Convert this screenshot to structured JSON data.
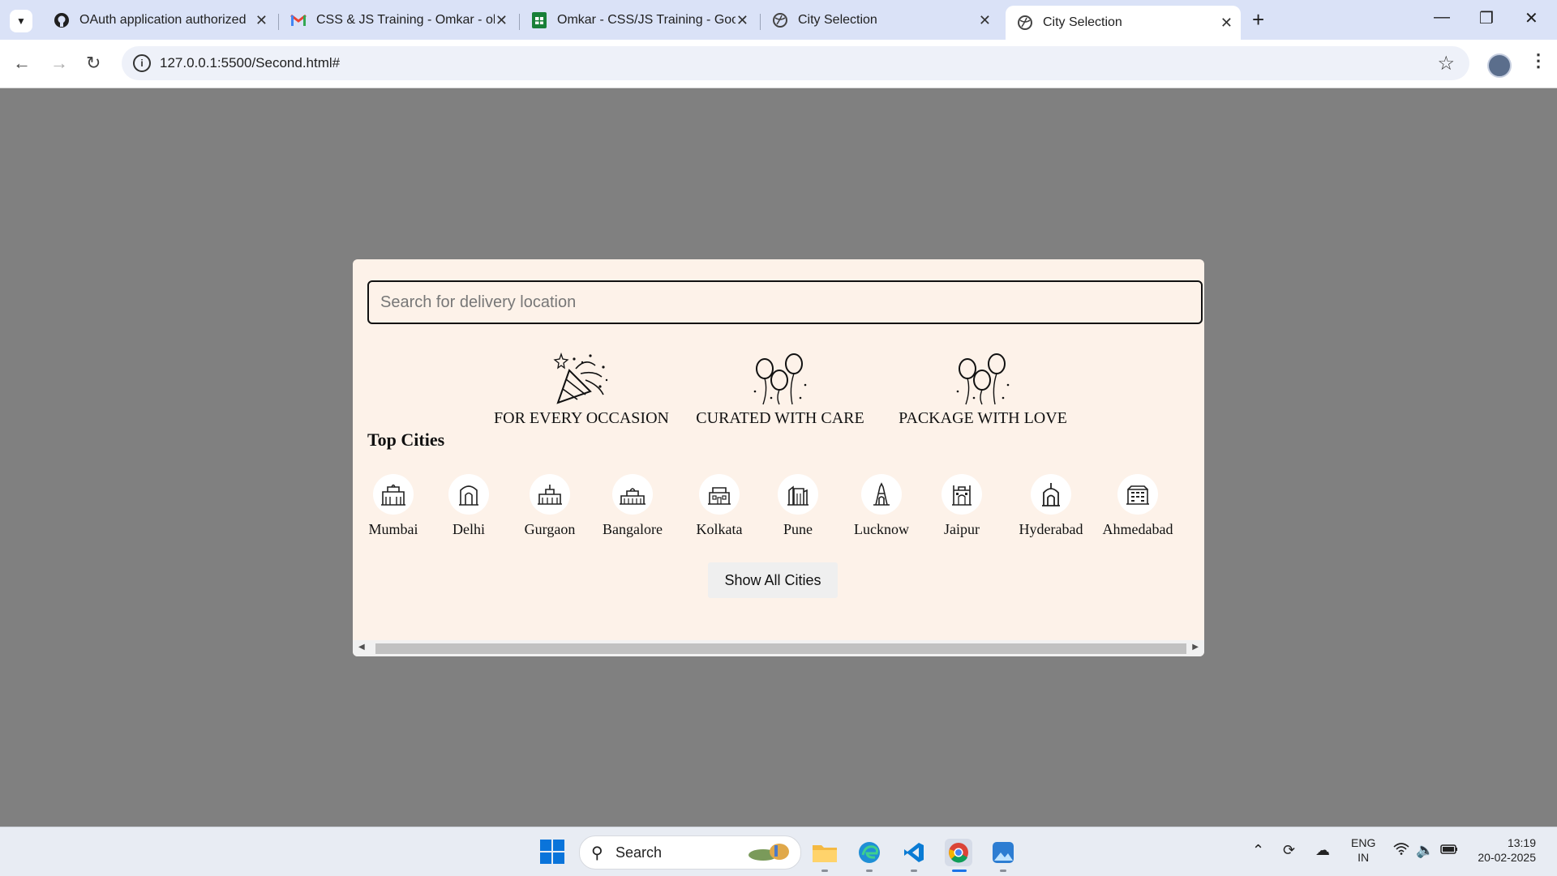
{
  "browser": {
    "tabs": [
      {
        "title": "OAuth application authorized",
        "icon": "github-icon",
        "active": false
      },
      {
        "title": "CSS & JS Training - Omkar - ok",
        "icon": "gmail-icon",
        "active": false
      },
      {
        "title": "Omkar - CSS/JS Training - Goo",
        "icon": "sheets-icon",
        "active": false
      },
      {
        "title": "City Selection",
        "icon": "globe-icon",
        "active": false
      },
      {
        "title": "City Selection",
        "icon": "globe-icon",
        "active": true
      }
    ],
    "url": "127.0.0.1:5500/Second.html#"
  },
  "page": {
    "search_placeholder": "Search for delivery location",
    "features": [
      {
        "label": "FOR EVERY OCCASION",
        "icon": "party-popper-icon"
      },
      {
        "label": "CURATED WITH CARE",
        "icon": "balloons-icon"
      },
      {
        "label": "PACKAGE WITH LOVE",
        "icon": "balloons-icon"
      }
    ],
    "top_cities_title": "Top Cities",
    "cities": [
      {
        "name": "Mumbai",
        "icon": "mumbai-landmark-icon"
      },
      {
        "name": "Delhi",
        "icon": "delhi-landmark-icon"
      },
      {
        "name": "Gurgaon",
        "icon": "gurgaon-landmark-icon"
      },
      {
        "name": "Bangalore",
        "icon": "bangalore-landmark-icon"
      },
      {
        "name": "Kolkata",
        "icon": "kolkata-landmark-icon"
      },
      {
        "name": "Pune",
        "icon": "pune-landmark-icon"
      },
      {
        "name": "Lucknow",
        "icon": "lucknow-landmark-icon"
      },
      {
        "name": "Jaipur",
        "icon": "jaipur-landmark-icon"
      },
      {
        "name": "Hyderabad",
        "icon": "hyderabad-landmark-icon"
      },
      {
        "name": "Ahmedabad",
        "icon": "ahmedabad-landmark-icon"
      }
    ],
    "show_all_label": "Show All Cities"
  },
  "taskbar": {
    "search_label": "Search",
    "lang": "ENG",
    "region": "IN",
    "time": "13:19",
    "date": "20-02-2025"
  }
}
